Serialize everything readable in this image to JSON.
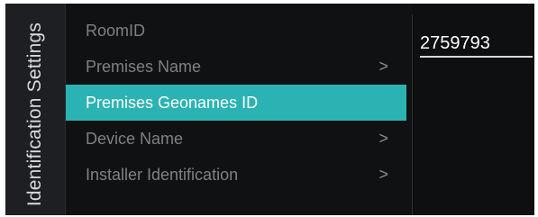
{
  "panel": {
    "title": "Identification Settings"
  },
  "menu": {
    "items": [
      {
        "label": "RoomID",
        "has_submenu": false,
        "selected": false
      },
      {
        "label": "Premises Name",
        "has_submenu": true,
        "selected": false,
        "chevron": ">"
      },
      {
        "label": "Premises Geonames ID",
        "has_submenu": false,
        "selected": true
      },
      {
        "label": "Device Name",
        "has_submenu": true,
        "selected": false,
        "chevron": ">"
      },
      {
        "label": "Installer Identification",
        "has_submenu": true,
        "selected": false,
        "chevron": ">"
      }
    ]
  },
  "value_pane": {
    "value": "2759793"
  },
  "colors": {
    "selection": "#2bb3b3",
    "background": "#0f1113",
    "text_dim": "#7e8285",
    "text_bright": "#ffffff"
  }
}
